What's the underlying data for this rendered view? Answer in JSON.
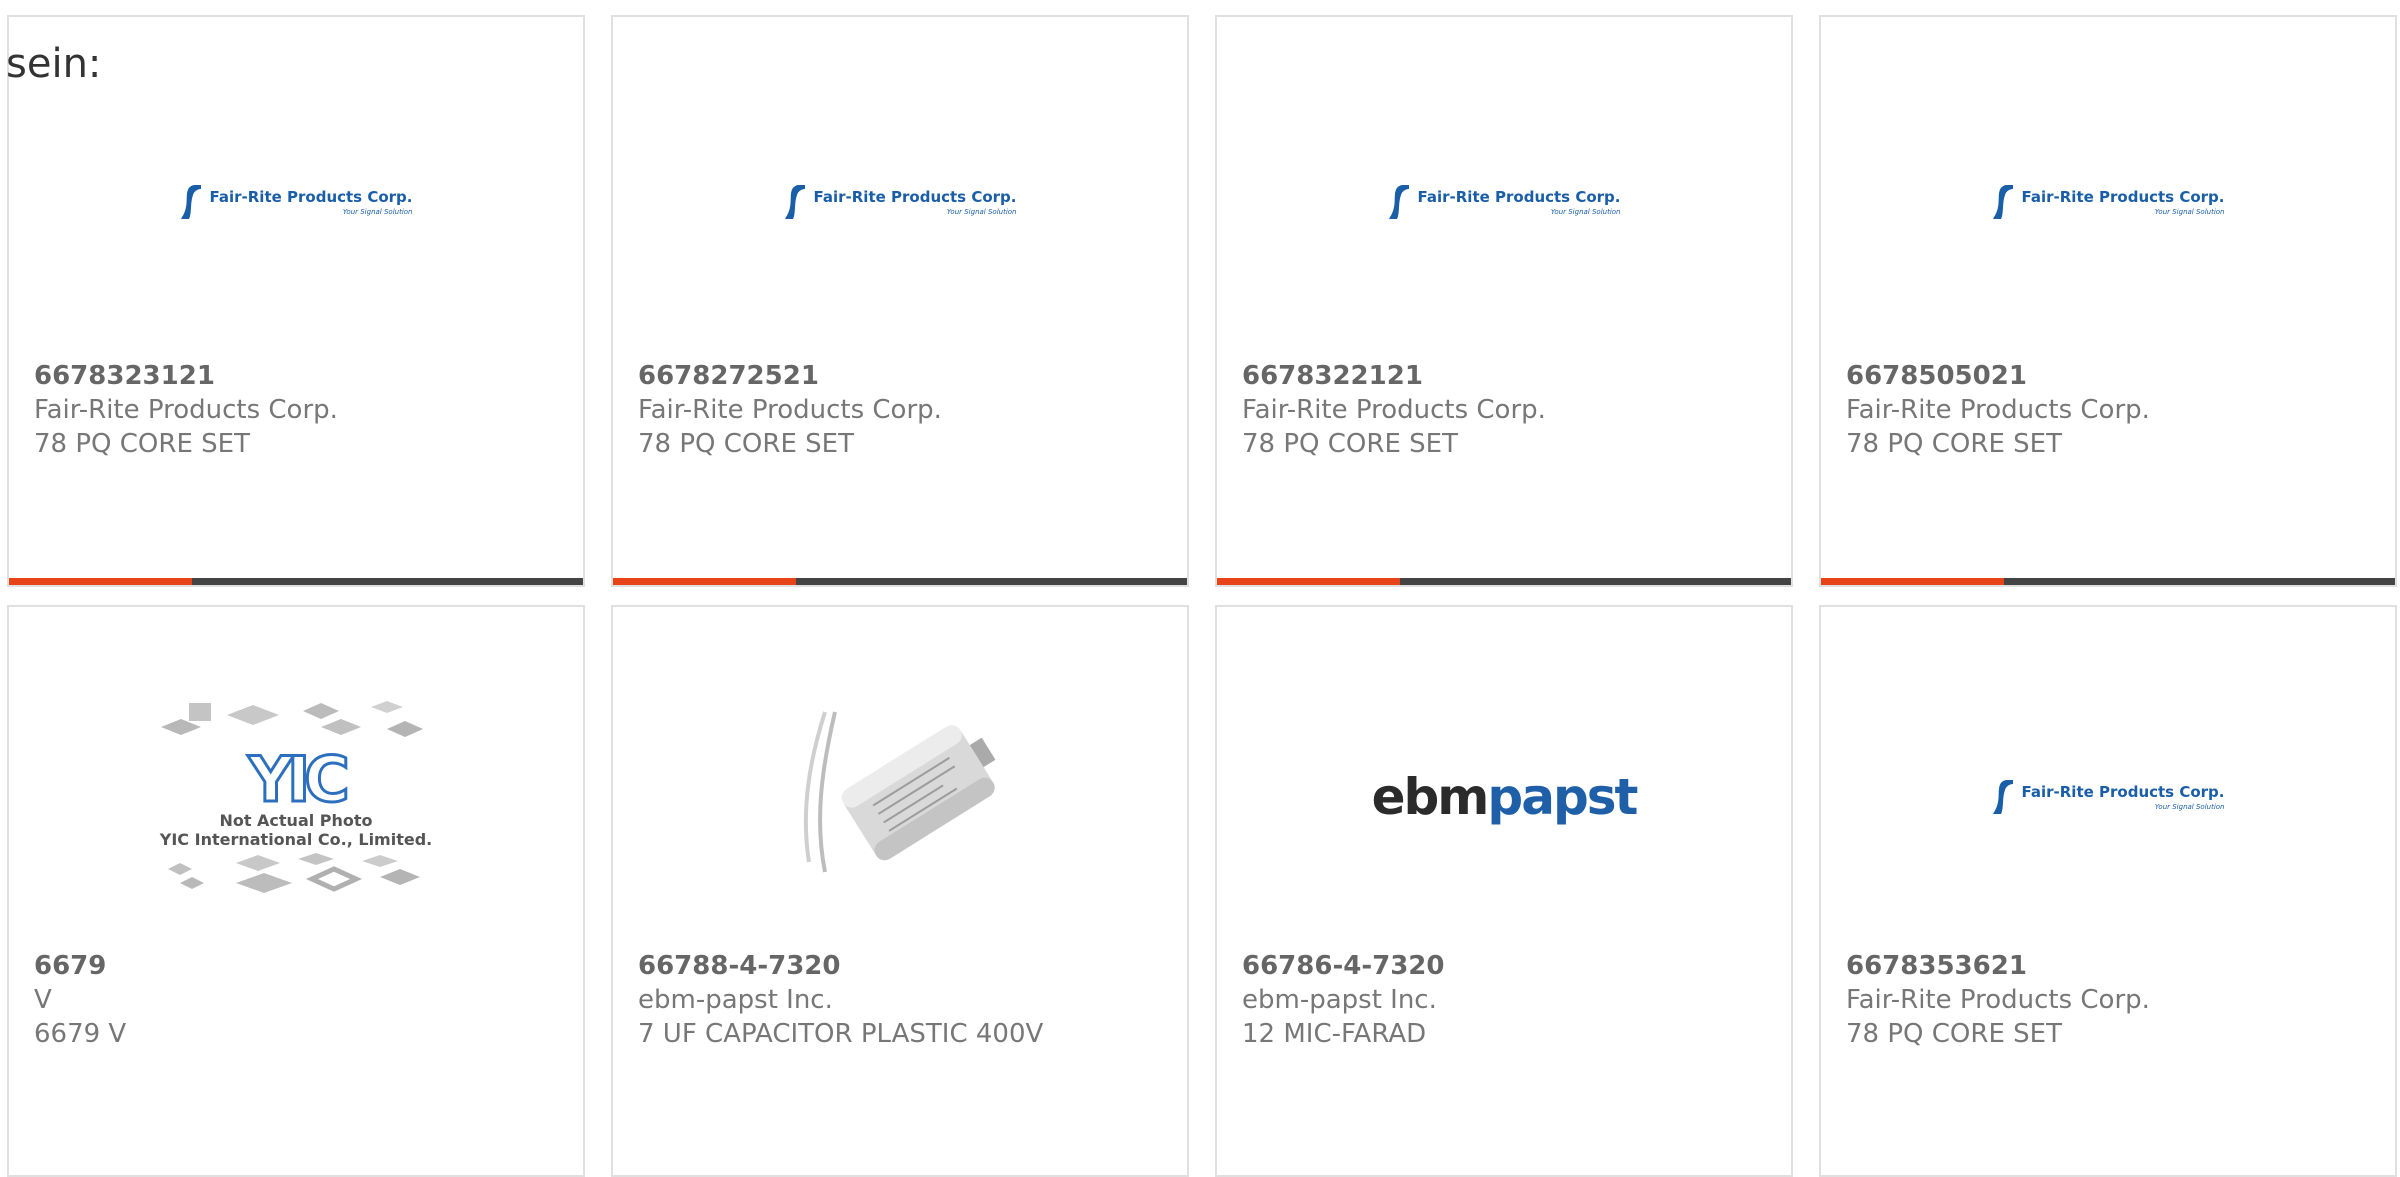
{
  "intro_text": "sein:",
  "colors": {
    "accent_bar": "#e8441a",
    "bar": "#444444",
    "fairrite_blue": "#1a5ea8",
    "ebm_blue": "#1f5fa8"
  },
  "logos": {
    "fairrite": {
      "name": "Fair-Rite Products Corp.",
      "tagline": "Your Signal Solution"
    },
    "yic": {
      "letters": "YIC",
      "note_line1": "Not Actual Photo",
      "note_line2": "YIC International Co., Limited."
    },
    "ebm": {
      "part1": "ebm",
      "part2": "papst"
    }
  },
  "products": [
    {
      "part": "6678323121",
      "manufacturer": "Fair-Rite Products Corp.",
      "description": "78 PQ CORE SET",
      "image": "fairrite-logo"
    },
    {
      "part": "6678272521",
      "manufacturer": "Fair-Rite Products Corp.",
      "description": "78 PQ CORE SET",
      "image": "fairrite-logo"
    },
    {
      "part": "6678322121",
      "manufacturer": "Fair-Rite Products Corp.",
      "description": "78 PQ CORE SET",
      "image": "fairrite-logo"
    },
    {
      "part": "6678505021",
      "manufacturer": "Fair-Rite Products Corp.",
      "description": "78 PQ CORE SET",
      "image": "fairrite-logo"
    },
    {
      "part": "6679",
      "manufacturer": "V",
      "description": "6679 V",
      "image": "yic-placeholder"
    },
    {
      "part": "66788-4-7320",
      "manufacturer": "ebm-papst Inc.",
      "description": "7 UF CAPACITOR PLASTIC 400V",
      "image": "capacitor-photo"
    },
    {
      "part": "66786-4-7320",
      "manufacturer": "ebm-papst Inc.",
      "description": "12 MIC-FARAD",
      "image": "ebmpapst-logo"
    },
    {
      "part": "6678353621",
      "manufacturer": "Fair-Rite Products Corp.",
      "description": "78 PQ CORE SET",
      "image": "fairrite-logo"
    }
  ]
}
